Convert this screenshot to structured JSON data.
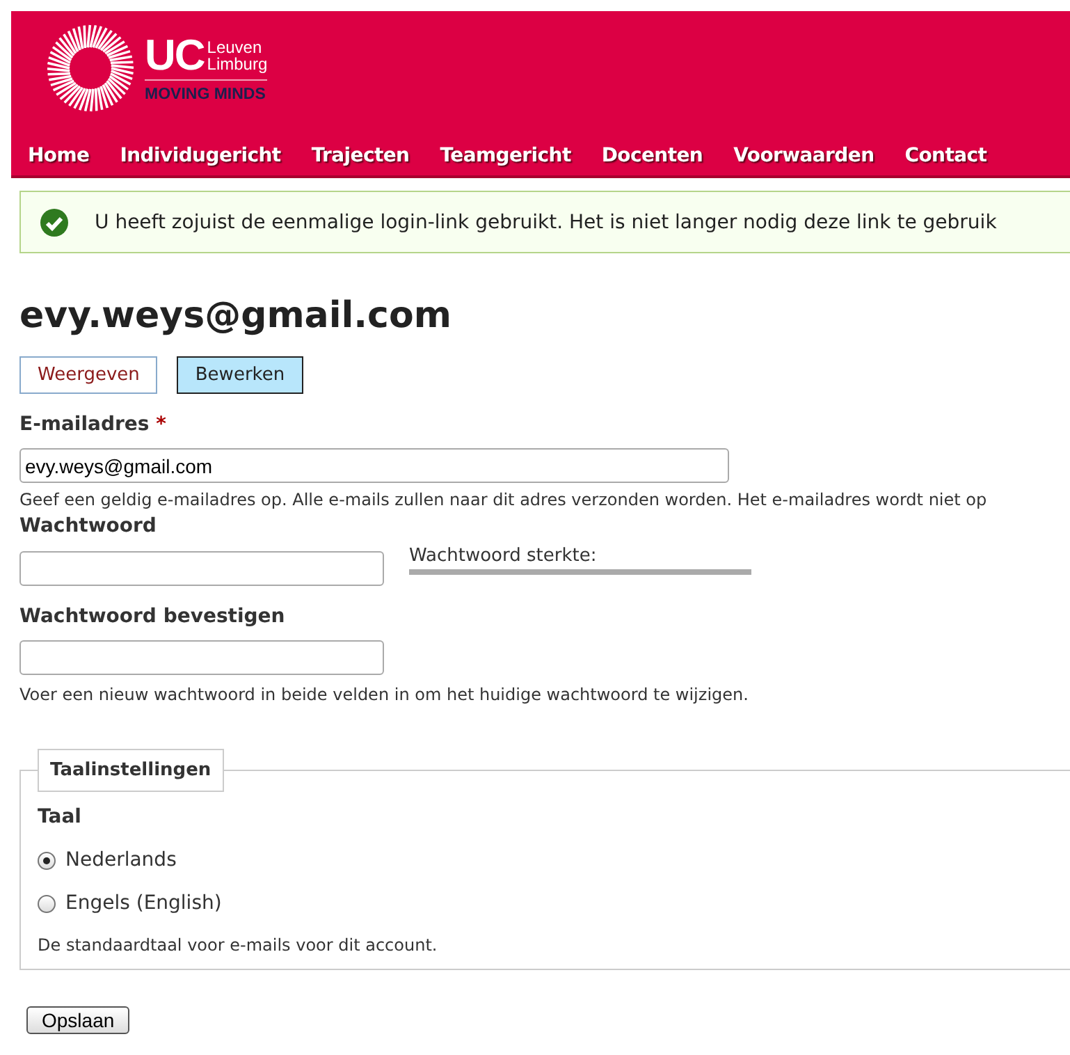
{
  "header": {
    "logo": {
      "mark": "UC",
      "lines": [
        "Leuven",
        "Limburg"
      ],
      "tagline": "MOVING MINDS"
    },
    "nav": [
      {
        "label": "Home"
      },
      {
        "label": "Individugericht"
      },
      {
        "label": "Trajecten"
      },
      {
        "label": "Teamgericht"
      },
      {
        "label": "Docenten"
      },
      {
        "label": "Voorwaarden"
      },
      {
        "label": "Contact"
      }
    ]
  },
  "status_message": {
    "text": "U heeft zojuist de eenmalige login-link gebruikt. Het is niet langer nodig deze link te gebruik"
  },
  "page_title": "evy.weys@gmail.com",
  "tabs": [
    {
      "label": "Weergeven",
      "selected": false
    },
    {
      "label": "Bewerken",
      "selected": true
    }
  ],
  "email": {
    "label": "E-mailadres",
    "required_mark": "*",
    "value": "evy.weys@gmail.com",
    "description": "Geef een geldig e-mailadres op. Alle e-mails zullen naar dit adres verzonden worden. Het e-mailadres wordt niet op"
  },
  "password": {
    "label": "Wachtwoord",
    "strength_label": "Wachtwoord sterkte:"
  },
  "password_confirm": {
    "label": "Wachtwoord bevestigen",
    "description": "Voer een nieuw wachtwoord in beide velden in om het huidige wachtwoord te wijzigen."
  },
  "language_settings": {
    "legend": "Taalinstellingen",
    "label": "Taal",
    "options": [
      {
        "label": "Nederlands",
        "selected": true
      },
      {
        "label": "Engels (English)",
        "selected": false
      }
    ],
    "description": "De standaardtaal voor e-mails voor dit account."
  },
  "buttons": [
    {
      "label": "Opslaan"
    }
  ]
}
